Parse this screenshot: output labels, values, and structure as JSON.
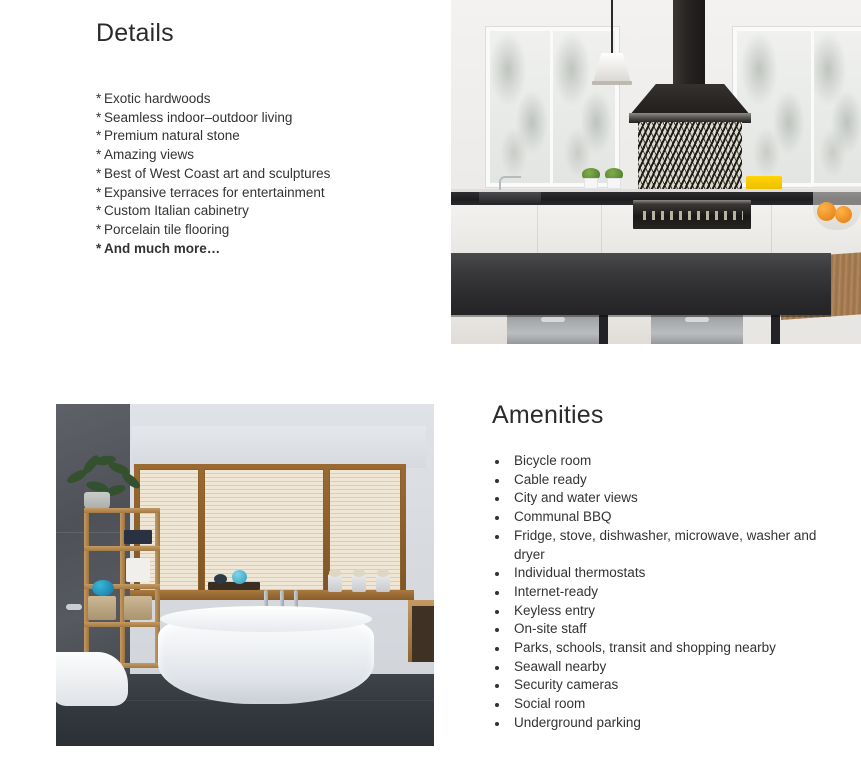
{
  "details": {
    "heading": "Details",
    "items": [
      {
        "marker": "*",
        "text": "Exotic hardwoods",
        "emphasis": false
      },
      {
        "marker": "*",
        "text": "Seamless indoor–outdoor living",
        "emphasis": false
      },
      {
        "marker": "*",
        "text": "Premium natural stone",
        "emphasis": false
      },
      {
        "marker": "*",
        "text": "Amazing views",
        "emphasis": false
      },
      {
        "marker": "*",
        "text": "Best of West Coast art and sculptures",
        "emphasis": false
      },
      {
        "marker": "*",
        "text": "Expansive terraces for entertainment",
        "emphasis": false
      },
      {
        "marker": "*",
        "text": "Custom Italian cabinetry",
        "emphasis": false
      },
      {
        "marker": "*",
        "text": "Porcelain tile flooring",
        "emphasis": false
      },
      {
        "marker": "*",
        "text": "And much more…",
        "emphasis": true
      }
    ]
  },
  "amenities": {
    "heading": "Amenities",
    "items": [
      "Bicycle room",
      "Cable ready",
      "City and water views",
      "Communal BBQ",
      "Fridge, stove, dishwasher, microwave, washer and dryer",
      "Individual thermostats",
      "Internet-ready",
      "Keyless entry",
      "On-site staff",
      "Parks, schools, transit and shopping nearby",
      "Seawall nearby",
      "Security cameras",
      "Social room",
      "Underground parking"
    ]
  },
  "images": {
    "kitchen": {
      "alt": "Modern kitchen with black range hood, patterned backsplash and dark island",
      "caption": ""
    },
    "bathroom": {
      "alt": "Modern bathroom with freestanding white tub, wooden window blinds and dark tile floor",
      "caption": ""
    }
  },
  "colors": {
    "page_background": "#ffffff",
    "heading_text": "#2b2b2b",
    "body_text": "#333333",
    "accent_yellow": "#ffd400",
    "counter_dark": "#232325"
  }
}
